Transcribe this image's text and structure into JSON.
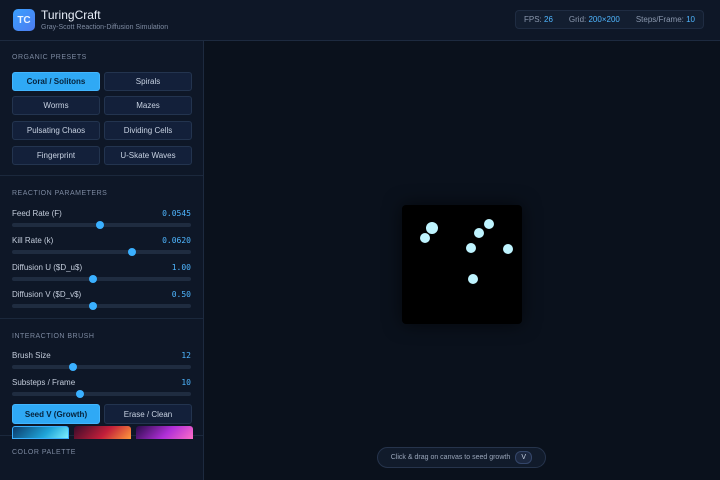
{
  "header": {
    "logo_text": "TC",
    "title": "TuringCraft",
    "subtitle": "Gray-Scott Reaction-Diffusion Simulation",
    "stats": [
      {
        "label": "FPS:",
        "value": "26"
      },
      {
        "label": "Grid:",
        "value": "200×200"
      },
      {
        "label": "Steps/Frame:",
        "value": "10"
      }
    ]
  },
  "sidebar": {
    "presets_label": "ORGANIC PRESETS",
    "presets": [
      {
        "label": "Coral / Solitons",
        "active": true
      },
      {
        "label": "Spirals",
        "active": false
      },
      {
        "label": "Worms",
        "active": false
      },
      {
        "label": "Mazes",
        "active": false
      },
      {
        "label": "Pulsating Chaos",
        "active": false
      },
      {
        "label": "Dividing Cells",
        "active": false
      },
      {
        "label": "Fingerprint",
        "active": false
      },
      {
        "label": "U-Skate Waves",
        "active": false
      }
    ],
    "reaction_label": "REACTION PARAMETERS",
    "params": [
      {
        "label": "Feed Rate (F)",
        "value": "0.0545",
        "level": 0.49
      },
      {
        "label": "Kill Rate (k)",
        "value": "0.0620",
        "level": 0.67
      },
      {
        "label": "Diffusion U ($D_u$)",
        "value": "1.00",
        "level": 0.45
      },
      {
        "label": "Diffusion V ($D_v$)",
        "value": "0.50",
        "level": 0.45
      }
    ],
    "brush_label": "INTERACTION BRUSH",
    "brush_params": [
      {
        "label": "Brush Size",
        "value": "12",
        "level": 0.34
      },
      {
        "label": "Substeps / Frame",
        "value": "10",
        "level": 0.38
      }
    ],
    "brush_modes": [
      {
        "label": "Seed V (Growth)",
        "active": true
      },
      {
        "label": "Erase / Clean",
        "active": false
      }
    ],
    "palette_label": "COLOR PALETTE"
  },
  "main": {
    "hint_text": "Click & drag on canvas to seed growth",
    "hint_key": "V"
  },
  "colors": {
    "accent": "#2fa9f5",
    "cell": "#bff4ff",
    "background": "#0b1220"
  }
}
